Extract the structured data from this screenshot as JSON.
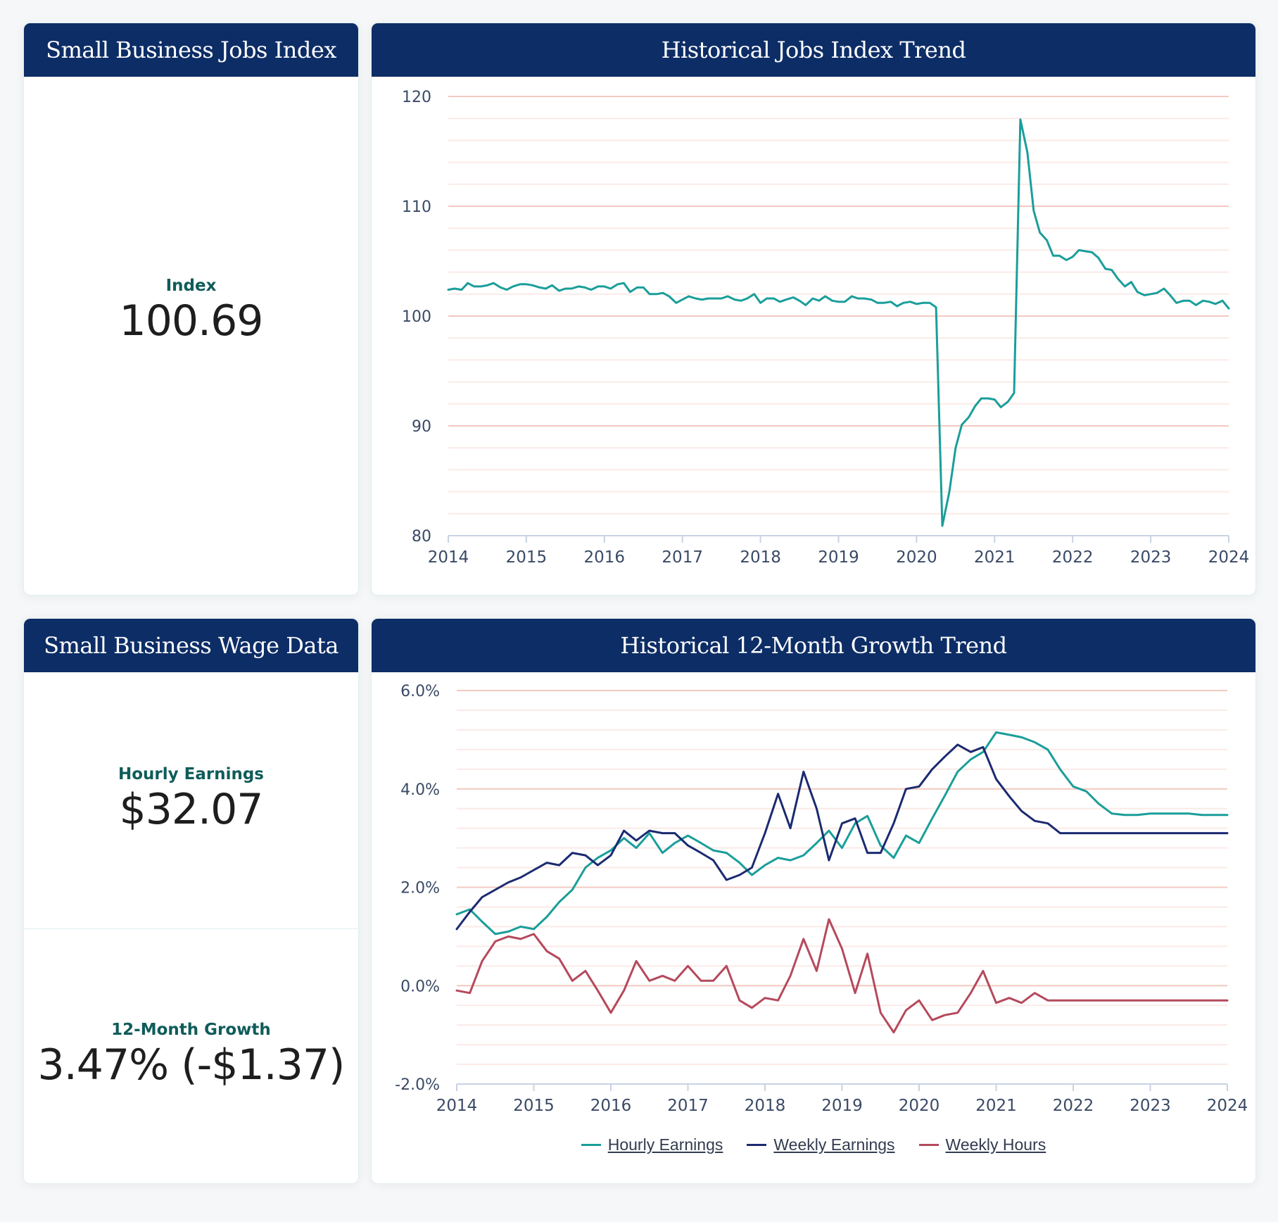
{
  "cards": {
    "jobs_index": {
      "title": "Small Business Jobs Index",
      "metric_label": "Index",
      "metric_value": "100.69"
    },
    "jobs_trend": {
      "title": "Historical Jobs Index Trend"
    },
    "wage_data": {
      "title": "Small Business Wage Data",
      "hourly_label": "Hourly Earnings",
      "hourly_value": "$32.07",
      "growth_label": "12-Month Growth",
      "growth_value": "3.47% (-$1.37)"
    },
    "growth_trend": {
      "title": "Historical 12-Month Growth Trend"
    }
  },
  "colors": {
    "header_bg": "#0d2d66",
    "hourly_earnings": "#1a9e9a",
    "weekly_earnings": "#1b2a70",
    "weekly_hours": "#b5495c",
    "jobs_index_line": "#1a9e9a",
    "major_grid": "#f2c9c0",
    "minor_grid": "#fbeae7",
    "axis": "#c9d2e3",
    "tick_text": "#3a4a66"
  },
  "chart_data": [
    {
      "type": "line",
      "title": "Historical Jobs Index Trend",
      "xlabel": "",
      "ylabel": "",
      "xlim": [
        2014,
        2024
      ],
      "ylim": [
        80,
        120
      ],
      "x_ticks": [
        "2014",
        "2015",
        "2016",
        "2017",
        "2018",
        "2019",
        "2020",
        "2021",
        "2022",
        "2023",
        "2024"
      ],
      "y_ticks": [
        "80",
        "90",
        "100",
        "110",
        "120"
      ],
      "y_tick_values": [
        80,
        90,
        100,
        110,
        120
      ],
      "minor_step": 2,
      "grid": true,
      "legend": "none",
      "series": [
        {
          "name": "Jobs Index",
          "x": [
            2014.0,
            2014.08,
            2014.17,
            2014.25,
            2014.33,
            2014.42,
            2014.5,
            2014.58,
            2014.67,
            2014.75,
            2014.83,
            2014.92,
            2015.0,
            2015.08,
            2015.17,
            2015.25,
            2015.33,
            2015.42,
            2015.5,
            2015.58,
            2015.67,
            2015.75,
            2015.83,
            2015.92,
            2016.0,
            2016.08,
            2016.17,
            2016.25,
            2016.33,
            2016.42,
            2016.5,
            2016.58,
            2016.67,
            2016.75,
            2016.83,
            2016.92,
            2017.0,
            2017.08,
            2017.17,
            2017.25,
            2017.33,
            2017.42,
            2017.5,
            2017.58,
            2017.67,
            2017.75,
            2017.83,
            2017.92,
            2018.0,
            2018.08,
            2018.17,
            2018.25,
            2018.33,
            2018.42,
            2018.5,
            2018.58,
            2018.67,
            2018.75,
            2018.83,
            2018.92,
            2019.0,
            2019.08,
            2019.17,
            2019.25,
            2019.33,
            2019.42,
            2019.5,
            2019.58,
            2019.67,
            2019.75,
            2019.83,
            2019.92,
            2020.0,
            2020.08,
            2020.17,
            2020.25,
            2020.33,
            2020.42,
            2020.5,
            2020.58,
            2020.67,
            2020.75,
            2020.83,
            2020.92,
            2021.0,
            2021.08,
            2021.17,
            2021.25,
            2021.33,
            2021.42,
            2021.5,
            2021.58,
            2021.67,
            2021.75,
            2021.83,
            2021.92,
            2022.0,
            2022.08,
            2022.17,
            2022.25,
            2022.33,
            2022.42,
            2022.5,
            2022.58,
            2022.67,
            2022.75,
            2022.83,
            2022.92,
            2023.0,
            2023.08,
            2023.17,
            2023.25,
            2023.33,
            2023.42,
            2023.5,
            2023.58,
            2023.67,
            2023.75,
            2023.83,
            2023.92,
            2024.0
          ],
          "values": [
            102.4,
            102.5,
            102.4,
            103.0,
            102.7,
            102.7,
            102.8,
            103.0,
            102.6,
            102.4,
            102.7,
            102.9,
            102.9,
            102.8,
            102.6,
            102.5,
            102.8,
            102.3,
            102.5,
            102.5,
            102.7,
            102.6,
            102.4,
            102.7,
            102.7,
            102.5,
            102.9,
            103.0,
            102.2,
            102.6,
            102.6,
            102.0,
            102.0,
            102.1,
            101.8,
            101.2,
            101.5,
            101.8,
            101.6,
            101.5,
            101.6,
            101.6,
            101.6,
            101.8,
            101.5,
            101.4,
            101.6,
            102.0,
            101.2,
            101.6,
            101.6,
            101.3,
            101.5,
            101.7,
            101.4,
            101.0,
            101.6,
            101.4,
            101.8,
            101.4,
            101.3,
            101.3,
            101.8,
            101.6,
            101.6,
            101.5,
            101.2,
            101.2,
            101.3,
            100.9,
            101.2,
            101.3,
            101.1,
            101.2,
            101.2,
            100.8,
            80.9,
            84.0,
            88.0,
            90.1,
            90.8,
            91.8,
            92.5,
            92.5,
            92.4,
            91.7,
            92.2,
            93.0,
            117.9,
            114.9,
            109.6,
            107.6,
            106.9,
            105.5,
            105.5,
            105.1,
            105.4,
            106.0,
            105.9,
            105.8,
            105.3,
            104.3,
            104.2,
            103.4,
            102.7,
            103.1,
            102.2,
            101.9,
            102.0,
            102.1,
            102.5,
            101.9,
            101.2,
            101.4,
            101.4,
            101.0,
            101.4,
            101.3,
            101.1,
            101.4,
            100.69
          ]
        }
      ]
    },
    {
      "type": "line",
      "title": "Historical 12-Month Growth Trend",
      "xlabel": "",
      "ylabel": "",
      "xlim": [
        2014,
        2024
      ],
      "ylim": [
        -2.0,
        6.0
      ],
      "x_ticks": [
        "2014",
        "2015",
        "2016",
        "2017",
        "2018",
        "2019",
        "2020",
        "2021",
        "2022",
        "2023",
        "2024"
      ],
      "y_ticks": [
        "-2.0%",
        "0.0%",
        "2.0%",
        "4.0%",
        "6.0%"
      ],
      "y_tick_values": [
        -2.0,
        0.0,
        2.0,
        4.0,
        6.0
      ],
      "minor_step": 0.4,
      "grid": true,
      "legend": "bottom-center",
      "series": [
        {
          "name": "Hourly Earnings",
          "x": [
            2014.0,
            2014.17,
            2014.33,
            2014.5,
            2014.67,
            2014.83,
            2015.0,
            2015.17,
            2015.33,
            2015.5,
            2015.67,
            2015.83,
            2016.0,
            2016.17,
            2016.33,
            2016.5,
            2016.67,
            2016.83,
            2017.0,
            2017.17,
            2017.33,
            2017.5,
            2017.67,
            2017.83,
            2018.0,
            2018.17,
            2018.33,
            2018.5,
            2018.67,
            2018.83,
            2019.0,
            2019.17,
            2019.33,
            2019.5,
            2019.67,
            2019.83,
            2020.0,
            2020.17,
            2020.33,
            2020.5,
            2020.67,
            2020.83,
            2021.0,
            2021.17,
            2021.33,
            2021.5,
            2021.67,
            2021.83,
            2022.0,
            2022.17,
            2022.33,
            2022.5,
            2022.67,
            2022.83,
            2023.0,
            2023.17,
            2023.33,
            2023.5,
            2023.67,
            2023.83,
            2024.0
          ],
          "values": [
            1.45,
            1.55,
            1.3,
            1.05,
            1.1,
            1.2,
            1.15,
            1.4,
            1.7,
            1.95,
            2.4,
            2.6,
            2.75,
            3.0,
            2.8,
            3.1,
            2.7,
            2.9,
            3.05,
            2.9,
            2.75,
            2.7,
            2.5,
            2.25,
            2.45,
            2.6,
            2.55,
            2.65,
            2.9,
            3.15,
            2.8,
            3.3,
            3.45,
            2.85,
            2.6,
            3.05,
            2.9,
            3.4,
            3.85,
            4.35,
            4.6,
            4.75,
            5.15,
            5.1,
            5.05,
            4.95,
            4.8,
            4.4,
            4.05,
            3.95,
            3.7,
            3.5,
            3.47,
            3.47,
            3.5,
            3.5,
            3.5,
            3.5,
            3.47,
            3.47,
            3.47
          ]
        },
        {
          "name": "Weekly Earnings",
          "x": [
            2014.0,
            2014.17,
            2014.33,
            2014.5,
            2014.67,
            2014.83,
            2015.0,
            2015.17,
            2015.33,
            2015.5,
            2015.67,
            2015.83,
            2016.0,
            2016.17,
            2016.33,
            2016.5,
            2016.67,
            2016.83,
            2017.0,
            2017.17,
            2017.33,
            2017.5,
            2017.67,
            2017.83,
            2018.0,
            2018.17,
            2018.33,
            2018.5,
            2018.67,
            2018.83,
            2019.0,
            2019.17,
            2019.33,
            2019.5,
            2019.67,
            2019.83,
            2020.0,
            2020.17,
            2020.33,
            2020.5,
            2020.67,
            2020.83,
            2021.0,
            2021.17,
            2021.33,
            2021.5,
            2021.67,
            2021.83,
            2022.0,
            2022.17,
            2022.33,
            2022.5,
            2022.67,
            2022.83,
            2023.0,
            2023.17,
            2023.33,
            2023.5,
            2023.67,
            2023.83,
            2024.0
          ],
          "values": [
            1.15,
            1.5,
            1.8,
            1.95,
            2.1,
            2.2,
            2.35,
            2.5,
            2.45,
            2.7,
            2.65,
            2.45,
            2.65,
            3.15,
            2.95,
            3.15,
            3.1,
            3.1,
            2.85,
            2.7,
            2.55,
            2.15,
            2.25,
            2.4,
            3.1,
            3.9,
            3.2,
            4.35,
            3.6,
            2.55,
            3.3,
            3.4,
            2.7,
            2.7,
            3.3,
            4.0,
            4.05,
            4.4,
            4.65,
            4.9,
            4.75,
            4.85,
            4.2,
            3.85,
            3.55,
            3.35,
            3.3,
            3.1,
            3.1,
            3.1,
            3.1,
            3.1,
            3.1,
            3.1,
            3.1,
            3.1,
            3.1,
            3.1,
            3.1,
            3.1,
            3.1
          ]
        },
        {
          "name": "Weekly Hours",
          "x": [
            2014.0,
            2014.17,
            2014.33,
            2014.5,
            2014.67,
            2014.83,
            2015.0,
            2015.17,
            2015.33,
            2015.5,
            2015.67,
            2015.83,
            2016.0,
            2016.17,
            2016.33,
            2016.5,
            2016.67,
            2016.83,
            2017.0,
            2017.17,
            2017.33,
            2017.5,
            2017.67,
            2017.83,
            2018.0,
            2018.17,
            2018.33,
            2018.5,
            2018.67,
            2018.83,
            2019.0,
            2019.17,
            2019.33,
            2019.5,
            2019.67,
            2019.83,
            2020.0,
            2020.17,
            2020.33,
            2020.5,
            2020.67,
            2020.83,
            2021.0,
            2021.17,
            2021.33,
            2021.5,
            2021.67,
            2021.83,
            2022.0,
            2022.17,
            2022.33,
            2022.5,
            2022.67,
            2022.83,
            2023.0,
            2023.17,
            2023.33,
            2023.5,
            2023.67,
            2023.83,
            2024.0
          ],
          "values": [
            -0.1,
            -0.15,
            0.5,
            0.9,
            1.0,
            0.95,
            1.05,
            0.7,
            0.55,
            0.1,
            0.3,
            -0.1,
            -0.55,
            -0.1,
            0.5,
            0.1,
            0.2,
            0.1,
            0.4,
            0.1,
            0.1,
            0.4,
            -0.3,
            -0.45,
            -0.25,
            -0.3,
            0.2,
            0.95,
            0.3,
            1.35,
            0.75,
            -0.15,
            0.65,
            -0.55,
            -0.95,
            -0.5,
            -0.3,
            -0.7,
            -0.6,
            -0.55,
            -0.15,
            0.3,
            -0.35,
            -0.25,
            -0.35,
            -0.15,
            -0.3,
            -0.3,
            -0.3,
            -0.3,
            -0.3,
            -0.3,
            -0.3,
            -0.3,
            -0.3,
            -0.3,
            -0.3,
            -0.3,
            -0.3,
            -0.3,
            -0.3
          ]
        }
      ]
    }
  ],
  "legend": {
    "items": [
      {
        "label": "Hourly Earnings",
        "color": "#1a9e9a"
      },
      {
        "label": "Weekly Earnings",
        "color": "#1b2a70"
      },
      {
        "label": "Weekly Hours",
        "color": "#b5495c"
      }
    ]
  }
}
